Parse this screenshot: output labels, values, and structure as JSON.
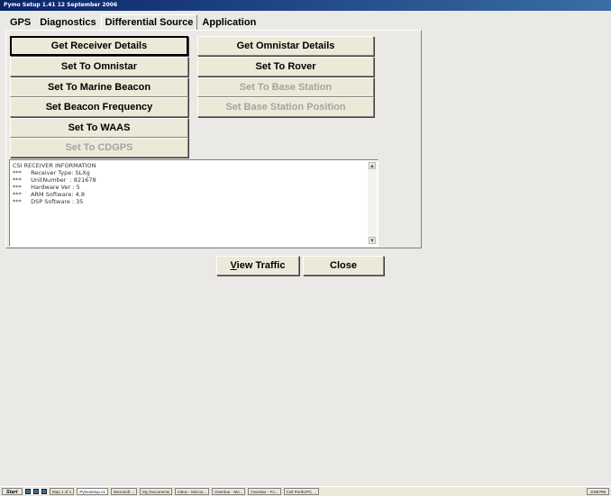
{
  "window": {
    "title": "Pymo Setup 1.41 12 September 2006"
  },
  "tabs": [
    {
      "label": "GPS"
    },
    {
      "label": "Diagnostics"
    },
    {
      "label": "Differential Source"
    },
    {
      "label": "Application"
    }
  ],
  "active_tab": "Differential Source",
  "buttons_left": [
    {
      "label": "Get Receiver Details",
      "enabled": true
    },
    {
      "label": "Set To Omnistar",
      "enabled": true
    },
    {
      "label": "Set To Marine Beacon",
      "enabled": true
    },
    {
      "label": "Set Beacon Frequency",
      "enabled": true
    },
    {
      "label": "Set To WAAS",
      "enabled": true
    },
    {
      "label": "Set To CDGPS",
      "enabled": false
    }
  ],
  "buttons_right": [
    {
      "label": "Get Omnistar Details",
      "enabled": true
    },
    {
      "label": "Set To Rover",
      "enabled": true
    },
    {
      "label": "Set To Base Station",
      "enabled": false
    },
    {
      "label": "Set Base Station Position",
      "enabled": false
    }
  ],
  "info_text": "CSI RECEIVER INFORMATION\n***     Receiver Type: SLXg\n***     UnitNumber  : 821678\n***     Hardware Ver : 5\n***     ARM Software: 4.8\n***     DSP Software : 35",
  "bottom_buttons": {
    "view_traffic_prefix": "V",
    "view_traffic_rest": "iew Traffic",
    "close": "Close"
  },
  "taskbar": {
    "start": "Start",
    "items": [
      "Step 1 of 1",
      "Pymosetup.v1",
      "Microsoft ...",
      "My Documents",
      "Inbox - Micros...",
      "Overdue - Mo...",
      "Overdue - Fo...",
      "Cell Perth1PC ..."
    ],
    "clock": "3:08 PM"
  }
}
